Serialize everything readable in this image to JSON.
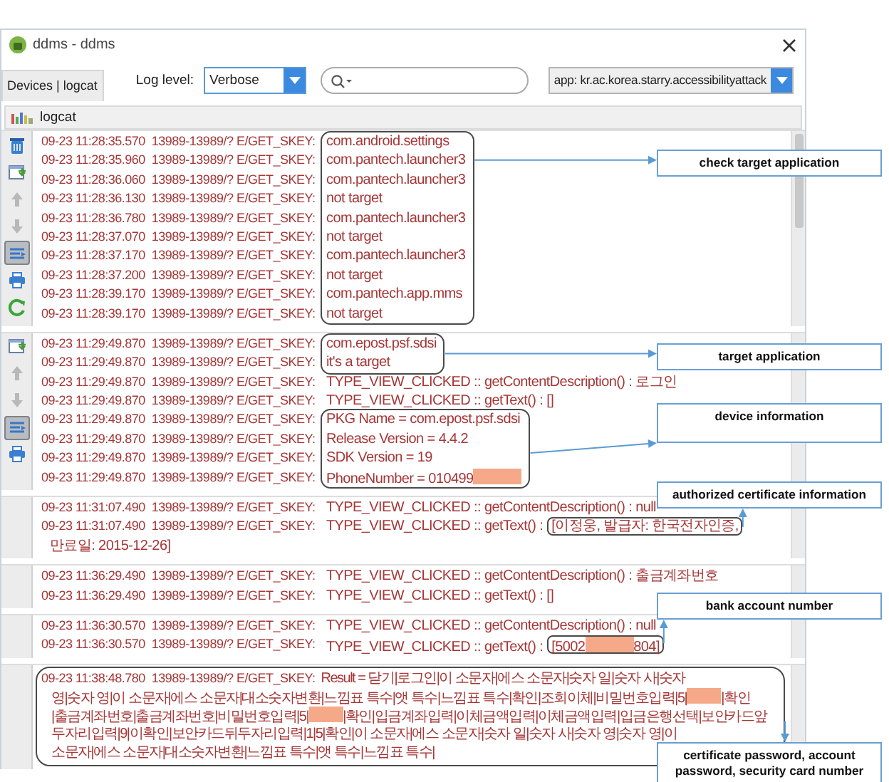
{
  "window": {
    "title": "ddms - ddms"
  },
  "toolbar": {
    "tab": "Devices | logcat",
    "log_level_label": "Log level:",
    "log_level": "Verbose",
    "app_filter": "app: kr.ac.korea.starry.accessibilityattack"
  },
  "logcat": {
    "title": "logcat"
  },
  "panels": [
    {
      "tools": [
        {
          "kind": "trash",
          "pressed": false
        },
        {
          "kind": "import",
          "pressed": false
        },
        {
          "kind": "up",
          "pressed": false
        },
        {
          "kind": "down",
          "pressed": false
        },
        {
          "kind": "filter",
          "pressed": true
        },
        {
          "kind": "print",
          "pressed": false
        },
        {
          "kind": "refresh",
          "pressed": false
        }
      ],
      "rows": [
        {
          "kind": "lines",
          "outlined": true,
          "lines": [
            {
              "prefix": "09-23 11:28:35.570  13989-13989/? E/GET_SKEY:",
              "parts": [
                {
                  "kind": "text",
                  "text": "com.android.settings"
                }
              ]
            },
            {
              "prefix": "09-23 11:28:35.960  13989-13989/? E/GET_SKEY:",
              "parts": [
                {
                  "kind": "text",
                  "text": "com.pantech.launcher3"
                }
              ]
            },
            {
              "prefix": "09-23 11:28:36.060  13989-13989/? E/GET_SKEY:",
              "parts": [
                {
                  "kind": "text",
                  "text": "com.pantech.launcher3"
                }
              ]
            },
            {
              "prefix": "09-23 11:28:36.130  13989-13989/? E/GET_SKEY:",
              "parts": [
                {
                  "kind": "text",
                  "text": "not target"
                }
              ]
            },
            {
              "prefix": "09-23 11:28:36.780  13989-13989/? E/GET_SKEY:",
              "parts": [
                {
                  "kind": "text",
                  "text": "com.pantech.launcher3"
                }
              ]
            },
            {
              "prefix": "09-23 11:28:37.070  13989-13989/? E/GET_SKEY:",
              "parts": [
                {
                  "kind": "text",
                  "text": "not target"
                }
              ]
            },
            {
              "prefix": "09-23 11:28:37.170  13989-13989/? E/GET_SKEY:",
              "parts": [
                {
                  "kind": "text",
                  "text": "com.pantech.launcher3"
                }
              ]
            },
            {
              "prefix": "09-23 11:28:37.200  13989-13989/? E/GET_SKEY:",
              "parts": [
                {
                  "kind": "text",
                  "text": "not target"
                }
              ]
            },
            {
              "prefix": "09-23 11:28:39.170  13989-13989/? E/GET_SKEY:",
              "parts": [
                {
                  "kind": "text",
                  "text": "com.pantech.app.mms"
                }
              ]
            },
            {
              "prefix": "09-23 11:28:39.170  13989-13989/? E/GET_SKEY:",
              "parts": [
                {
                  "kind": "text",
                  "text": "not target"
                }
              ]
            }
          ]
        }
      ]
    },
    {
      "tools": [
        {
          "kind": "import",
          "pressed": false
        },
        {
          "kind": "up",
          "pressed": false
        },
        {
          "kind": "down",
          "pressed": false
        },
        {
          "kind": "filter",
          "pressed": true
        },
        {
          "kind": "print",
          "pressed": false
        }
      ],
      "rows": [
        {
          "kind": "lines",
          "outlined": true,
          "lines": [
            {
              "prefix": "09-23 11:29:49.870  13989-13989/? E/GET_SKEY:",
              "parts": [
                {
                  "kind": "text",
                  "text": "com.epost.psf.sdsi"
                }
              ]
            },
            {
              "prefix": "09-23 11:29:49.870  13989-13989/? E/GET_SKEY:",
              "parts": [
                {
                  "kind": "text",
                  "text": "it's a target"
                }
              ]
            }
          ]
        },
        {
          "kind": "lines",
          "outlined": false,
          "lines": [
            {
              "prefix": "09-23 11:29:49.870  13989-13989/? E/GET_SKEY:",
              "parts": [
                {
                  "kind": "text",
                  "text": "TYPE_VIEW_CLICKED :: getContentDescription() : 로그인"
                }
              ]
            },
            {
              "prefix": "09-23 11:29:49.870  13989-13989/? E/GET_SKEY:",
              "parts": [
                {
                  "kind": "text",
                  "text": "TYPE_VIEW_CLICKED :: getText() : []"
                }
              ]
            }
          ]
        },
        {
          "kind": "lines",
          "outlined": true,
          "lines": [
            {
              "prefix": "09-23 11:29:49.870  13989-13989/? E/GET_SKEY:",
              "parts": [
                {
                  "kind": "text",
                  "text": "PKG Name = com.epost.psf.sdsi"
                }
              ]
            },
            {
              "prefix": "09-23 11:29:49.870  13989-13989/? E/GET_SKEY:",
              "parts": [
                {
                  "kind": "text",
                  "text": "Release Version = 4.4.2"
                }
              ]
            },
            {
              "prefix": "09-23 11:29:49.870  13989-13989/? E/GET_SKEY:",
              "parts": [
                {
                  "kind": "text",
                  "text": "SDK Version = 19"
                }
              ]
            },
            {
              "prefix": "09-23 11:29:49.870  13989-13989/? E/GET_SKEY:",
              "parts": [
                {
                  "kind": "text",
                  "text": "PhoneNumber = 010499"
                },
                {
                  "kind": "redacted"
                }
              ]
            }
          ]
        }
      ]
    },
    {
      "rows": [
        {
          "kind": "lines",
          "outlined": false,
          "lines": [
            {
              "prefix": "09-23 11:31:07.490  13989-13989/? E/GET_SKEY:",
              "parts": [
                {
                  "kind": "text",
                  "text": "TYPE_VIEW_CLICKED :: getContentDescription() : null"
                }
              ]
            },
            {
              "prefix": "09-23 11:31:07.490  13989-13989/? E/GET_SKEY:",
              "parts": [
                {
                  "kind": "text",
                  "text": "TYPE_VIEW_CLICKED :: getText() :"
                }
              ],
              "highlight": [
                {
                  "kind": "text",
                  "text": "[이정웅, 발급자: 한국전자인증,"
                }
              ]
            }
          ]
        },
        {
          "kind": "wrap",
          "parts": [
            {
              "kind": "text",
              "text": "만료일: 2015-12-26]"
            }
          ]
        }
      ]
    },
    {
      "rows": [
        {
          "kind": "lines",
          "outlined": false,
          "lines": [
            {
              "prefix": "09-23 11:36:29.490  13989-13989/? E/GET_SKEY:",
              "parts": [
                {
                  "kind": "text",
                  "text": "TYPE_VIEW_CLICKED :: getContentDescription() : 출금계좌번호"
                }
              ]
            },
            {
              "prefix": "09-23 11:36:29.490  13989-13989/? E/GET_SKEY:",
              "parts": [
                {
                  "kind": "text",
                  "text": "TYPE_VIEW_CLICKED :: getText() : []"
                }
              ]
            }
          ]
        }
      ]
    },
    {
      "rows": [
        {
          "kind": "lines",
          "outlined": false,
          "lines": [
            {
              "prefix": "09-23 11:36:30.570  13989-13989/? E/GET_SKEY:",
              "parts": [
                {
                  "kind": "text",
                  "text": "TYPE_VIEW_CLICKED :: getContentDescription() : null"
                }
              ]
            },
            {
              "prefix": "09-23 11:36:30.570  13989-13989/? E/GET_SKEY:",
              "parts": [
                {
                  "kind": "text",
                  "text": "TYPE_VIEW_CLICKED :: getText() :"
                }
              ],
              "highlight": [
                {
                  "kind": "text",
                  "text": "[5002"
                },
                {
                  "kind": "redacted"
                },
                {
                  "kind": "text",
                  "text": "804]"
                }
              ]
            }
          ]
        }
      ]
    },
    {
      "rows": [
        {
          "kind": "paragraph",
          "outlined": true,
          "prefix": "09-23 11:38:48.780  13989-13989/? E/GET_SKEY:",
          "lines": [
            {
              "parts": [
                {
                  "kind": "text",
                  "text": "Result = 닫기|로그인|이 소문자|에스 소문자|숫자 일|숫자 사|숫자"
                }
              ]
            },
            {
              "parts": [
                {
                  "kind": "text",
                  "text": "영|숫자 영|이 소문자|에스 소문자|대소숫자변환|느낌표 특수|앳 특수|느낌표 특수|확인|조회이체|비밀번호입력|5|"
                },
                {
                  "kind": "redacted"
                },
                {
                  "kind": "text",
                  "text": "|확인"
                }
              ]
            },
            {
              "parts": [
                {
                  "kind": "text",
                  "text": "|출금계좌번호|출금계좌번호|비밀번호입력|5|"
                },
                {
                  "kind": "redacted"
                },
                {
                  "kind": "text",
                  "text": "|확인|입금계좌입력|이체금액입력|이체금액입력|입금은행선택|보안카드앞"
                }
              ]
            },
            {
              "parts": [
                {
                  "kind": "text",
                  "text": "두자리입력|9|이확인|보안카드뒤두자리입력|1|5|확인|이 소문자|에스 소문자|숫자 일|숫자 사|숫자 영|숫자 영|이"
                }
              ]
            },
            {
              "parts": [
                {
                  "kind": "text",
                  "text": "소문자|에스 소문자|대소숫자변환|느낌표 특수|앳 특수|느낌표 특수|"
                }
              ]
            }
          ]
        }
      ]
    }
  ],
  "callouts": [
    {
      "text": "check target application"
    },
    {
      "text": "target application"
    },
    {
      "text": "device information"
    },
    {
      "text": "authorized certificate information"
    },
    {
      "text": "bank account number"
    },
    {
      "text": "certificate password, account password, security card number"
    }
  ]
}
